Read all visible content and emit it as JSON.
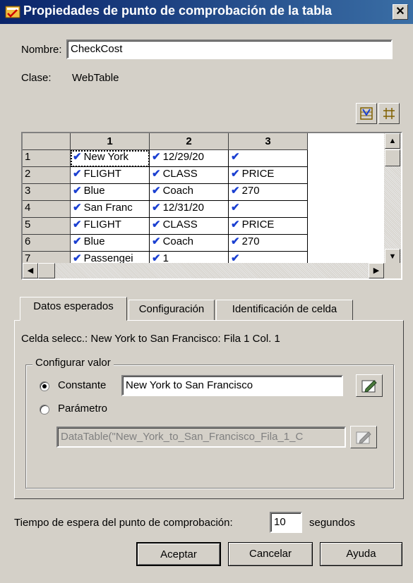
{
  "window": {
    "title": "Propiedades de punto de comprobación de la tabla",
    "close_label": "✕"
  },
  "nombre": {
    "label": "Nombre:",
    "value": "CheckCost"
  },
  "clase": {
    "label": "Clase:",
    "value": "WebTable"
  },
  "toolbar": {
    "icons": [
      "select-all-checks-icon",
      "grid-icon"
    ]
  },
  "table": {
    "columns": [
      "1",
      "2",
      "3"
    ],
    "rows": [
      {
        "num": "1",
        "cells": [
          "New York",
          "12/29/20",
          ""
        ]
      },
      {
        "num": "2",
        "cells": [
          "FLIGHT",
          "CLASS",
          "PRICE"
        ]
      },
      {
        "num": "3",
        "cells": [
          "Blue",
          "Coach",
          "270"
        ]
      },
      {
        "num": "4",
        "cells": [
          "San Franc",
          "12/31/20",
          ""
        ]
      },
      {
        "num": "5",
        "cells": [
          "FLIGHT",
          "CLASS",
          "PRICE"
        ]
      },
      {
        "num": "6",
        "cells": [
          "Blue",
          "Coach",
          "270"
        ]
      },
      {
        "num": "7",
        "cells": [
          "Passengei",
          "1",
          ""
        ]
      }
    ],
    "check_color": "#1a3fd1"
  },
  "tabs": [
    {
      "label": "Datos esperados",
      "active": true
    },
    {
      "label": "Configuración",
      "active": false
    },
    {
      "label": "Identificación de celda",
      "active": false
    }
  ],
  "selected_cell": "Celda selecc.: New York to San Francisco: Fila 1 Col. 1",
  "configurar": {
    "title": "Configurar valor",
    "constante_label": "Constante",
    "constante_value": "New York to San Francisco",
    "parametro_label": "Parámetro",
    "parametro_value": "DataTable(\"New_York_to_San_Francisco_Fila_1_C",
    "selected": "constante"
  },
  "timeout": {
    "label": "Tiempo de espera del punto de comprobación:",
    "value": "10",
    "unit": "segundos"
  },
  "buttons": {
    "ok": "Aceptar",
    "cancel": "Cancelar",
    "help": "Ayuda"
  }
}
